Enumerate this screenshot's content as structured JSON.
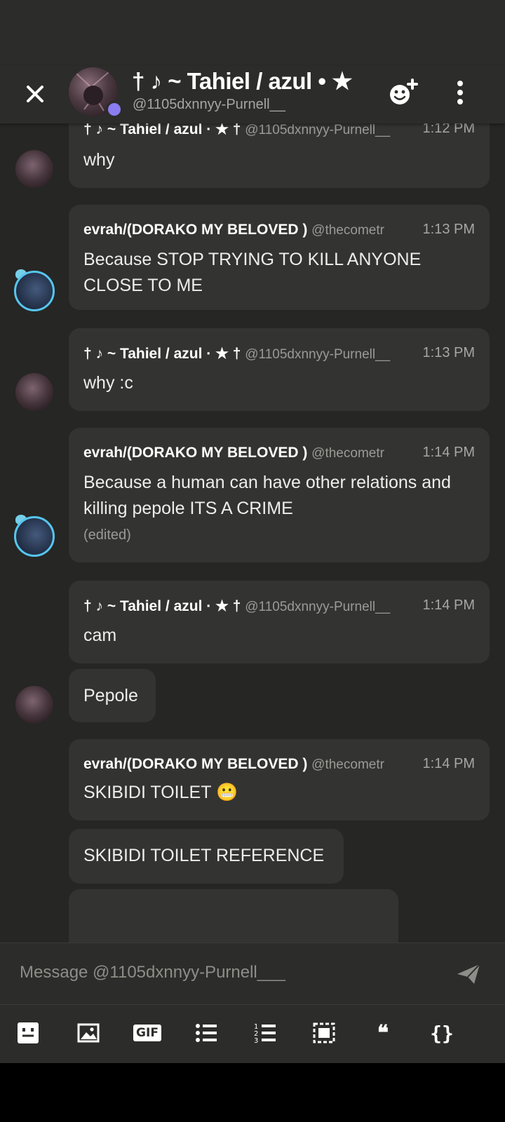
{
  "header": {
    "name": "† ♪ ~ Tahiel / azul • ★",
    "handle": "@1105dxnnyy-Purnell__"
  },
  "messages": [
    {
      "author": "† ♪ ~ Tahiel / azul · ★ †",
      "handle": "@1105dxnnyy-Purnell__",
      "time": "1:12 PM",
      "text": "why"
    },
    {
      "author": "evrah/(DORAKO MY BELOVED )",
      "handle": "@thecometr",
      "time": "1:13 PM",
      "text": "Because STOP TRYING TO KILL ANYONE CLOSE TO ME"
    },
    {
      "author": "† ♪ ~ Tahiel / azul · ★ †",
      "handle": "@1105dxnnyy-Purnell__",
      "time": "1:13 PM",
      "text": "why :c"
    },
    {
      "author": "evrah/(DORAKO MY BELOVED )",
      "handle": "@thecometr",
      "time": "1:14 PM",
      "text": "Because a human can have other relations and killing pepole ITS A CRIME",
      "edited": "(edited)"
    },
    {
      "author": "† ♪ ~ Tahiel / azul · ★ †",
      "handle": "@1105dxnnyy-Purnell__",
      "time": "1:14 PM",
      "text": "cam"
    },
    {
      "text": "Pepole"
    },
    {
      "author": "evrah/(DORAKO MY BELOVED )",
      "handle": "@thecometr",
      "time": "1:14 PM",
      "text": "SKIBIDI TOILET 😬"
    },
    {
      "text": "SKIBIDI TOILET REFERENCE"
    }
  ],
  "composer": {
    "placeholder": "Message @1105dxnnyy-Purnell___"
  },
  "toolbar": {
    "gif_label": "GIF",
    "quote_label": "❝",
    "code_label": "{}"
  },
  "colors": {
    "background": "#262624",
    "bubble": "#333331",
    "header": "#2c2c2a",
    "presence": "#8a7df0",
    "avatar_ring": "#56c6ee"
  }
}
